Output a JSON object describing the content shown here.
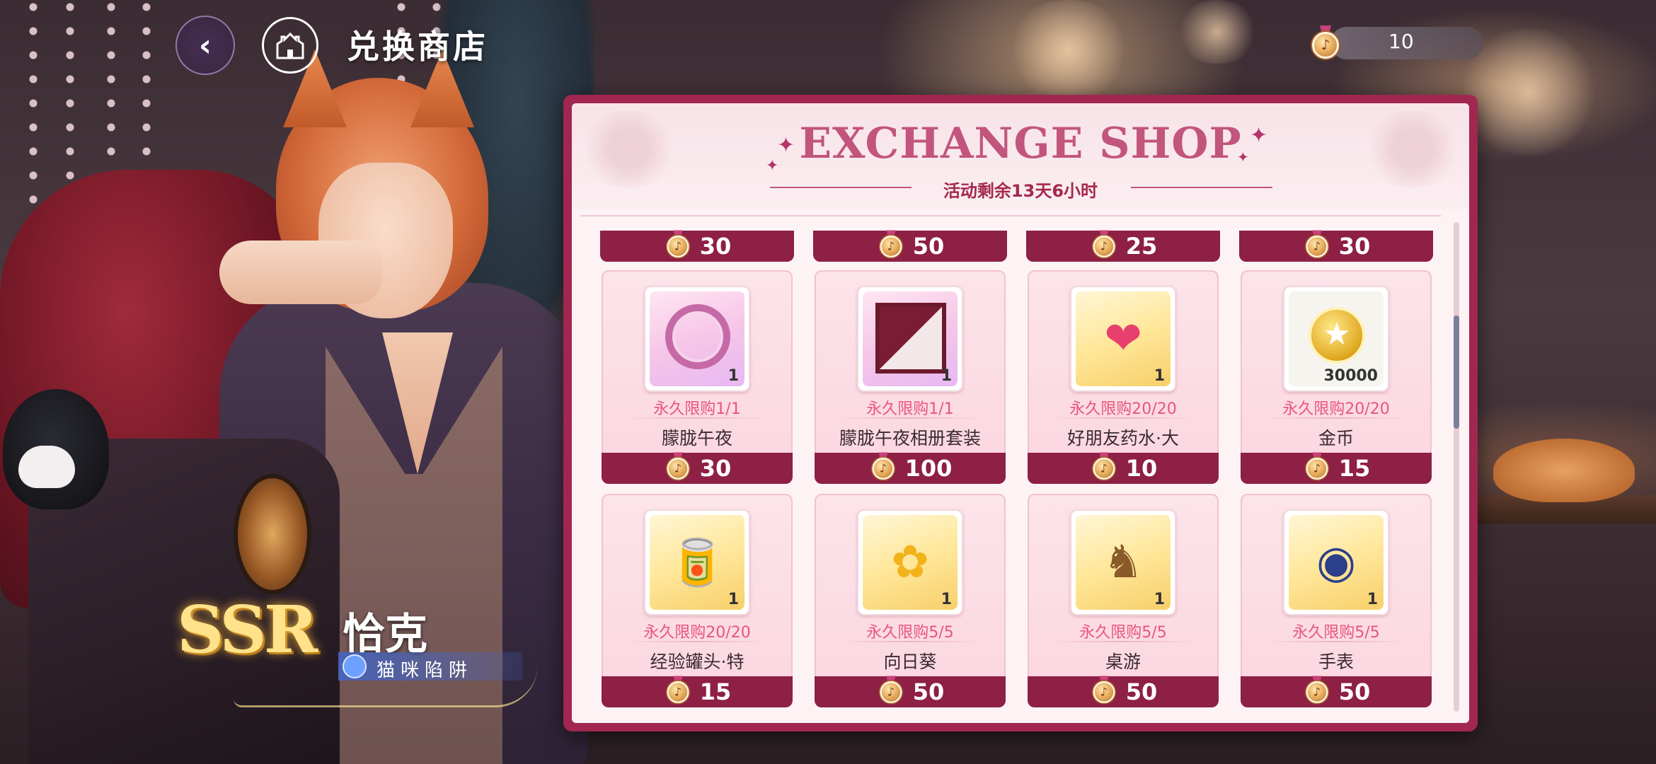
{
  "header": {
    "title": "兑换商店",
    "currency_amount": "10"
  },
  "character": {
    "rarity": "SSR",
    "name": "恰克",
    "title": "猫咪陷阱"
  },
  "shop": {
    "title": "EXCHANGE SHOP",
    "timer": "活动剩余13天6小时",
    "partial_row_prices": [
      "30",
      "50",
      "25",
      "30"
    ],
    "items": [
      {
        "name": "朦胧午夜",
        "limit": "永久限购1/1",
        "qty": "1",
        "price": "30",
        "icon": "pink-ring-frame-icon"
      },
      {
        "name": "朦胧午夜相册套装",
        "limit": "永久限购1/1",
        "qty": "1",
        "price": "100",
        "icon": "photo-album-icon"
      },
      {
        "name": "好朋友药水·大",
        "limit": "永久限购20/20",
        "qty": "1",
        "price": "10",
        "icon": "heart-potion-icon"
      },
      {
        "name": "金币",
        "limit": "永久限购20/20",
        "qty": "30000",
        "price": "15",
        "icon": "gold-coin-icon"
      },
      {
        "name": "经验罐头·特",
        "limit": "永久限购20/20",
        "qty": "1",
        "price": "15",
        "icon": "exp-can-icon"
      },
      {
        "name": "向日葵",
        "limit": "永久限购5/5",
        "qty": "1",
        "price": "50",
        "icon": "sunflower-bouquet-icon"
      },
      {
        "name": "桌游",
        "limit": "永久限购5/5",
        "qty": "1",
        "price": "50",
        "icon": "board-game-icon"
      },
      {
        "name": "手表",
        "limit": "永久限购5/5",
        "qty": "1",
        "price": "50",
        "icon": "pocket-watch-icon"
      }
    ]
  },
  "colors": {
    "panel_border": "#a12650",
    "price_bar": "#8e1f45",
    "limit_text": "#e8557c",
    "title_pink": "#c2557d"
  }
}
